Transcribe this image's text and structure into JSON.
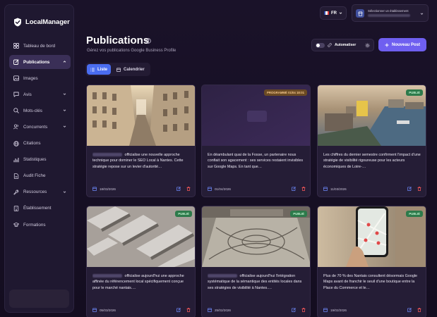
{
  "app": {
    "name": "LocalManager"
  },
  "sidebar": {
    "items": [
      {
        "label": "Tableau de bord",
        "icon": "layout-grid-icon",
        "active": false,
        "chevron": "none"
      },
      {
        "label": "Publications",
        "icon": "edit-icon",
        "active": true,
        "chevron": "up"
      },
      {
        "label": "Images",
        "icon": "image-icon",
        "active": false,
        "chevron": "none"
      },
      {
        "label": "Avis",
        "icon": "message-icon",
        "active": false,
        "chevron": "down"
      },
      {
        "label": "Mots-clés",
        "icon": "search-icon",
        "active": false,
        "chevron": "down"
      },
      {
        "label": "Concurrents",
        "icon": "users-icon",
        "active": false,
        "chevron": "down"
      },
      {
        "label": "Citations",
        "icon": "globe-icon",
        "active": false,
        "chevron": "none"
      },
      {
        "label": "Statistiques",
        "icon": "bar-chart-icon",
        "active": false,
        "chevron": "none"
      },
      {
        "label": "Audit Fiche",
        "icon": "file-icon",
        "active": false,
        "chevron": "none"
      },
      {
        "label": "Ressources",
        "icon": "wrench-icon",
        "active": false,
        "chevron": "down"
      },
      {
        "label": "Établissement",
        "icon": "building-icon",
        "active": false,
        "chevron": "none"
      },
      {
        "label": "Formations",
        "icon": "graduation-icon",
        "active": false,
        "chevron": "none"
      }
    ]
  },
  "topbar": {
    "language": "FR",
    "establishment_label": "Sélectionner un établissement"
  },
  "header": {
    "title": "Publications",
    "subtitle": "Gérez vos publications Google Business Profile",
    "automate_label": "Automatiser",
    "new_post_label": "Nouveau Post"
  },
  "view_tabs": [
    {
      "label": "Liste",
      "active": true
    },
    {
      "label": "Calendrier",
      "active": false
    }
  ],
  "posts": [
    {
      "text": " officialise une nouvelle approche technique pour dominer le SEO Local à Nantes. Cette stratégie repose sur un levier d'autorité…",
      "redacted_prefix": true,
      "date": "18/03/2026",
      "badge": "",
      "image": "street"
    },
    {
      "text": "En déambulant quai de la Fosse, un partenaire nous confiait son agacement : ses services restaient invisibles sur Google Maps. En tant que…",
      "redacted_prefix": false,
      "date": "01/04/2026",
      "badge": "PROGRAMMÉ 01/04 18:01",
      "image": "none"
    },
    {
      "text": "Les chiffres du dernier semestre confirment l'impact d'une stratégie de visibilité rigoureuse pour les acteurs économiques de Loire-…",
      "redacted_prefix": false,
      "date": "11/03/2026",
      "badge": "PUBLIÉ",
      "image": "river"
    },
    {
      "text": " officialise aujourd'hui une approche affinée du référencement local spécifiquement conçue pour le marché nantais.…",
      "redacted_prefix": true,
      "date": "05/03/2026",
      "badge": "PUBLIÉ",
      "image": "aerial"
    },
    {
      "text": " officialise aujourd'hui l'intégration systématique de la sémantique des entités locales dans ses stratégies de visibilité à Nantes.…",
      "redacted_prefix": true,
      "date": "25/02/2026",
      "badge": "PUBLIÉ",
      "image": "plaza"
    },
    {
      "text": "Plus de 70 % des Nantais consultent désormais Google Maps avant de franchir le seuil d'une boutique entre la Place du Commerce et le…",
      "redacted_prefix": false,
      "date": "19/02/2026",
      "badge": "PUBLIÉ",
      "image": "phone"
    }
  ],
  "colors": {
    "accent": "#6f5ff0",
    "active_tab": "#4a6df0",
    "published": "#2d7a4b",
    "scheduled": "#6b4a24",
    "icon_blue": "#6f8cff",
    "icon_red": "#ff5a5a"
  }
}
